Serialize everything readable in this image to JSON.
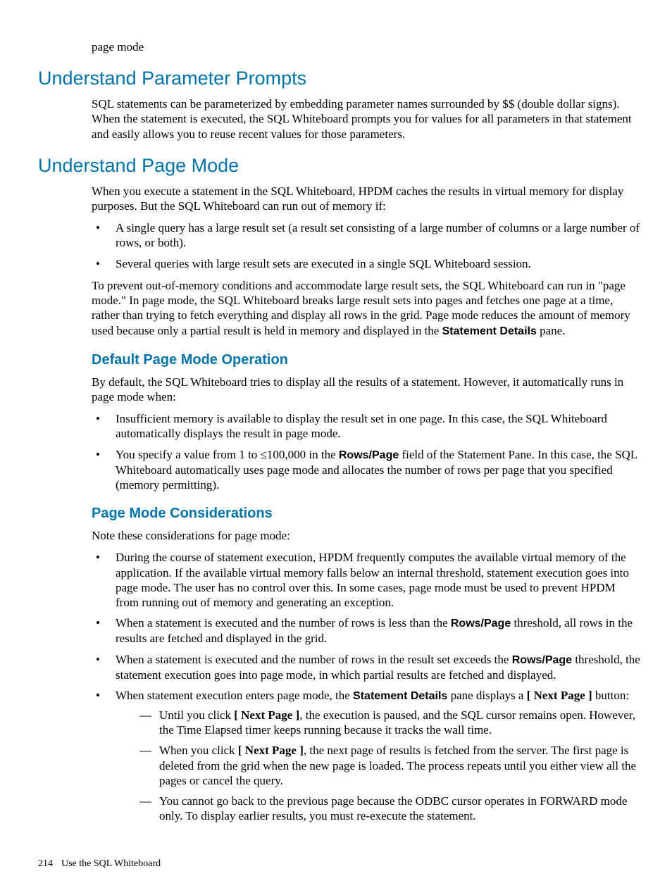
{
  "header_indent_text": "page mode",
  "sec1": {
    "title": "Understand Parameter Prompts",
    "p1": "SQL statements can be parameterized by embedding parameter names surrounded by $$ (double dollar signs). When the statement is executed, the SQL Whiteboard prompts you for values for all parameters in that statement and easily allows you to reuse recent values for those parameters."
  },
  "sec2": {
    "title": "Understand Page Mode",
    "p1": "When you execute a statement in the SQL Whiteboard, HPDM caches the results in virtual memory for display purposes. But the SQL Whiteboard can run out of memory if:",
    "bullets1": [
      "A single query has a large result set (a result set consisting of a large number of columns or a large number of rows, or both).",
      "Several queries with large result sets are executed in a single SQL Whiteboard session."
    ],
    "p2_a": "To prevent out-of-memory conditions and accommodate large result sets, the SQL Whiteboard can run in \"page mode.\" In page mode, the SQL Whiteboard breaks large result sets into pages and fetches one page at a time, rather than trying to fetch everything and display all rows in the grid. Page mode reduces the amount of memory used because only a partial result is held in memory and displayed in the ",
    "p2_b": "Statement Details",
    "p2_c": " pane.",
    "sub1": {
      "title": "Default Page Mode Operation",
      "p1": "By default, the SQL Whiteboard tries to display all the results of a statement. However, it automatically runs in page mode when:",
      "b1_0": "Insufficient memory is available to display the result set in one page. In this case, the SQL Whiteboard automatically displays the result in page mode.",
      "b2_a": "You specify a value from 1 to ≤100,000 in the ",
      "b2_b": "Rows/Page",
      "b2_c": " field of the Statement Pane. In this case, the SQL Whiteboard automatically uses page mode and allocates the number of rows per page that you specified (memory permitting)."
    },
    "sub2": {
      "title": "Page Mode Considerations",
      "p1": "Note these considerations for page mode:",
      "b1": "During the course of statement execution, HPDM frequently computes the available virtual memory of the application. If the available virtual memory falls below an internal threshold, statement execution goes into page mode. The user has no control over this. In some cases, page mode must be used to prevent HPDM from running out of memory and generating an exception.",
      "b2_a": "When a statement is executed and the number of rows is less than the ",
      "b2_b": "Rows/Page",
      "b2_c": " threshold, all rows in the results are fetched and displayed in the grid.",
      "b3_a": "When a statement is executed and the number of rows in the result set exceeds the ",
      "b3_b": "Rows/Page",
      "b3_c": " threshold, the statement execution goes into page mode, in which partial results are fetched and displayed.",
      "b4_a": "When statement execution enters page mode, the ",
      "b4_b": "Statement Details",
      "b4_c": " pane displays a ",
      "b4_d": "[ Next Page ]",
      "b4_e": " button:",
      "d1_a": "Until you click ",
      "d1_b": "[ Next Page ]",
      "d1_c": ", the execution is paused, and the SQL cursor remains open. However, the Time Elapsed timer keeps running because it tracks the wall time.",
      "d2_a": "When you click ",
      "d2_b": "[ Next Page ]",
      "d2_c": ", the next page of results is fetched from the server. The first page is deleted from the grid when the new page is loaded. The process repeats until you either view all the pages or cancel the query.",
      "d3": "You cannot go back to the previous page because the ODBC cursor operates in FORWARD mode only. To display earlier results, you must re-execute the statement."
    }
  },
  "footer": {
    "page": "214",
    "section": "Use the SQL Whiteboard"
  }
}
